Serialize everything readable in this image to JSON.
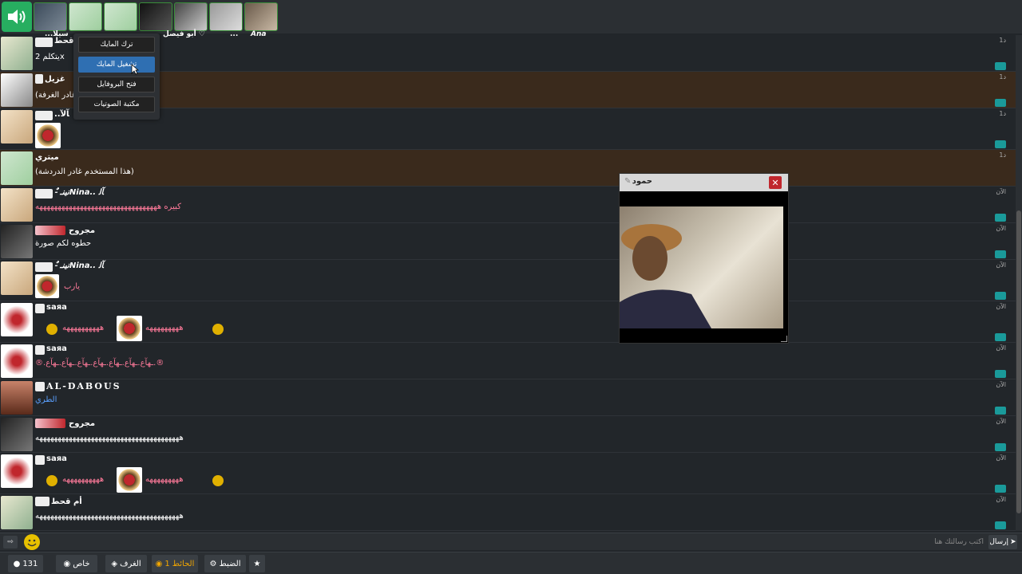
{
  "colors": {
    "accent_green": "#27ae60",
    "highlight_row": "#3a2a1c",
    "menu_active": "#2f6fb2",
    "close_red": "#c0272d",
    "reply_teal": "#1a9a9a",
    "pink_text": "#ff7a9a"
  },
  "topbar": {
    "mic_names": [
      "...سيلا",
      "أبو فيصل ♡",
      "...",
      "Ana"
    ]
  },
  "context_menu": {
    "items": [
      "ترك المايك",
      "تشغيل المايك",
      "فتح البروفايل",
      "مكتبة الصوتيات"
    ],
    "active_index": 1
  },
  "messages": [
    {
      "name": "أم قحط",
      "text": "يتكلم 2x",
      "time": "1د"
    },
    {
      "name": "غزيل",
      "text": "(هذا المستخدم غادر الغرفة)",
      "time": "1د"
    },
    {
      "name": "..ﺂﻟﺂ",
      "text": "",
      "time": "1د"
    },
    {
      "name": "ميتري",
      "text": "(هذا المستخدم غادر الدردشة)",
      "time": "1د"
    },
    {
      "name": "-ٌ نينـNina.. ﺂﻟ",
      "text": "كبيره هههههههههههههههههههههههههههههههههه",
      "time": "الآن"
    },
    {
      "name": "مجروح",
      "text": "حطوه لكم صورة",
      "time": "الآن"
    },
    {
      "name": "-ٌ نينـNina.. ﺂﻟ",
      "text": "يارب",
      "time": "الآن"
    },
    {
      "name": "saяa",
      "text_left": "ههههههههههه",
      "text_right": "هههههههههه",
      "time": "الآن"
    },
    {
      "name": "saяa",
      "text": "®.ـهآع.ـهآع.ـهآع.ـهآع.ـهآع.ـهآع.ـهآع.®",
      "time": "الآن"
    },
    {
      "name": "AL-DABOUS",
      "text": "الطري",
      "time": "الآن"
    },
    {
      "name": "مجروح",
      "text": "هههههههههههههههههههههههههههههههههههههههه",
      "time": "الآن"
    },
    {
      "name": "saяa",
      "text_left": "ههههههههههه",
      "text_right": "هههههههههه",
      "time": "الآن"
    },
    {
      "name": "أم قحط",
      "text": "هههههههههههههههههههههههههههههههههههههههه",
      "time": "الآن"
    }
  ],
  "video": {
    "title": "حمود",
    "close_glyph": "✕"
  },
  "input": {
    "placeholder": "اكتب رسالتك هنا",
    "send_label": "إرسال",
    "left_glyph": "⇨"
  },
  "bottombar": {
    "users_count": "131",
    "private_label": "خاص",
    "rooms_label": "الغرف",
    "wall_label": "الحائط",
    "wall_count": "1",
    "settings_label": "الضبط"
  }
}
